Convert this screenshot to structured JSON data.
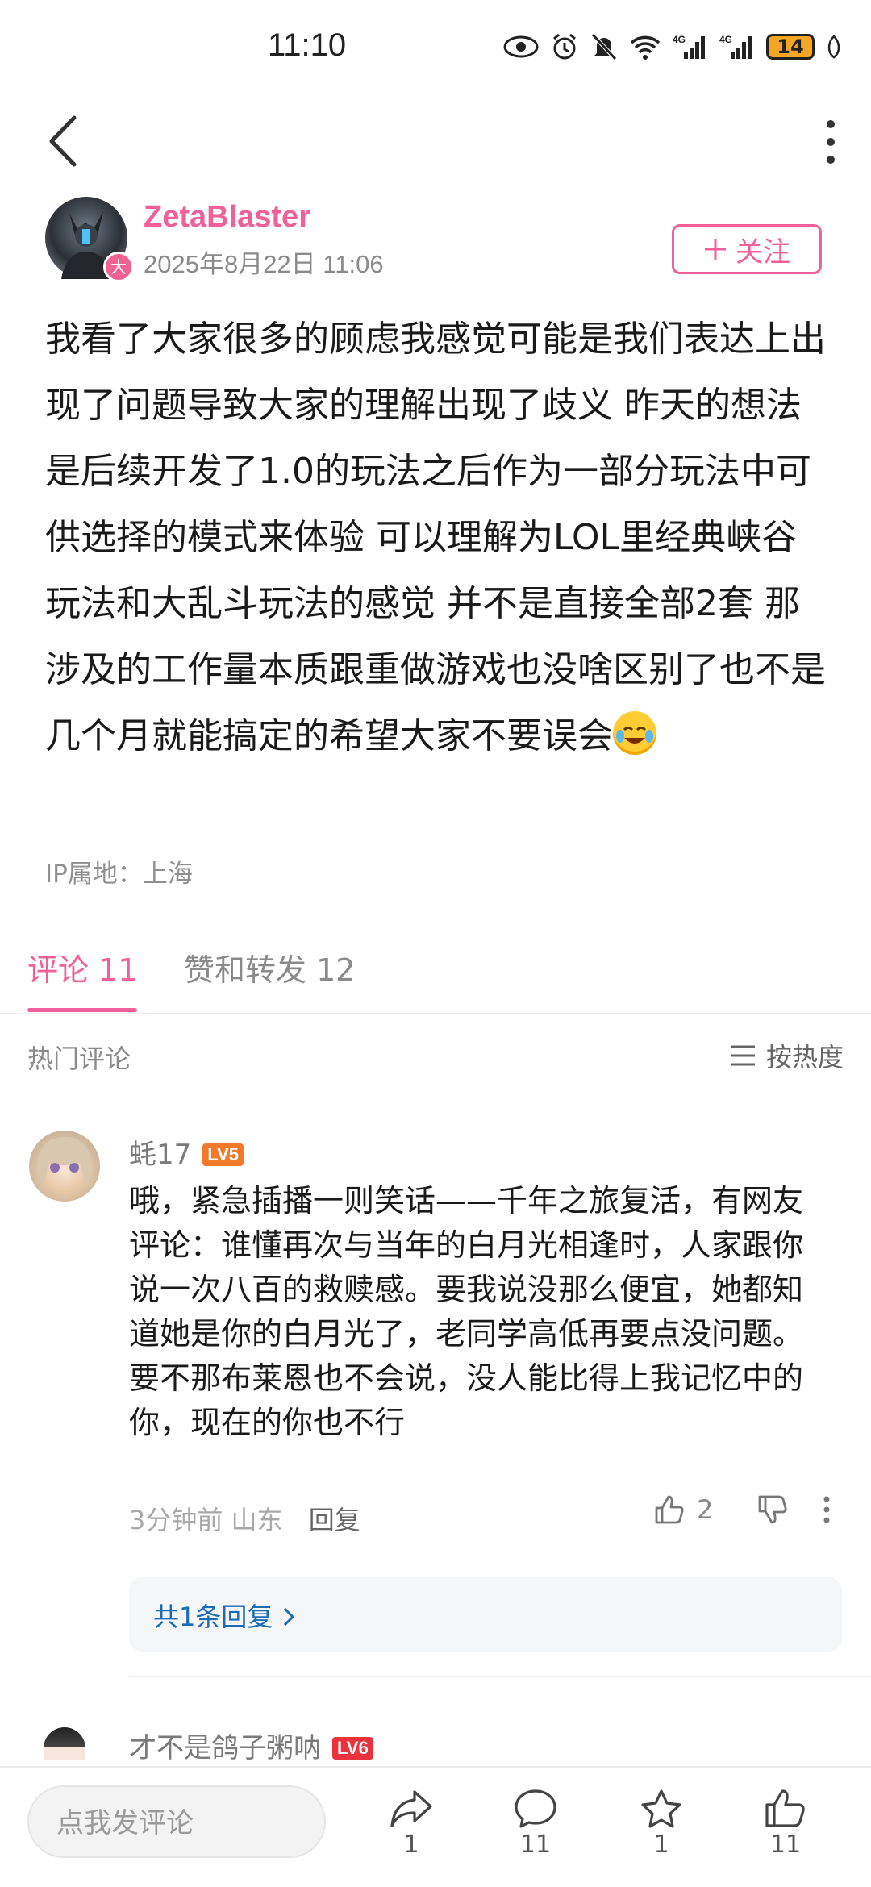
{
  "status_bar": {
    "time": "11:10",
    "battery": "14",
    "network_1": "4G",
    "network_2": "4G",
    "wifi_badge": "6"
  },
  "post": {
    "author": "ZetaBlaster",
    "author_badge": "大",
    "date": "2025年8月22日 11:06",
    "follow_label": "关注",
    "body": "我看了大家很多的顾虑我感觉可能是我们表达上出现了问题导致大家的理解出现了歧义 昨天的想法是后续开发了1.0的玩法之后作为一部分玩法中可供选择的模式来体验 可以理解为LOL里经典峡谷玩法和大乱斗玩法的感觉 并不是直接全部2套 那涉及的工作量本质跟重做游戏也没啥区别了也不是几个月就能搞定的希望大家不要误会",
    "ip_location": "IP属地：上海"
  },
  "tabs": [
    {
      "label": "评论 11",
      "active": true
    },
    {
      "label": "赞和转发 12",
      "active": false
    }
  ],
  "section": {
    "title": "热门评论",
    "sort_label": "按热度"
  },
  "comments": [
    {
      "user": "蚝17",
      "level": "LV5",
      "level_color": "#f07a2a",
      "text": "哦，紧急插播一则笑话——千年之旅复活，有网友评论：谁懂再次与当年的白月光相逢时，人家跟你说一次八百的救赎感。要我说没那么便宜，她都知道她是你的白月光了，老同学高低再要点没问题。要不那布莱恩也不会说，没人能比得上我记忆中的你，现在的你也不行",
      "time": "3分钟前",
      "location": "山东",
      "reply_label": "回复",
      "likes": "2",
      "replies_link": "共1条回复"
    },
    {
      "user": "才不是鸽子粥呐",
      "level": "LV6",
      "level_color": "#e8323c"
    }
  ],
  "bottom_bar": {
    "input_placeholder": "点我发评论",
    "share_count": "1",
    "comment_count": "11",
    "favorite_count": "1",
    "like_count": "11"
  },
  "colors": {
    "accent": "#f0609a",
    "link": "#1b6bb5"
  }
}
